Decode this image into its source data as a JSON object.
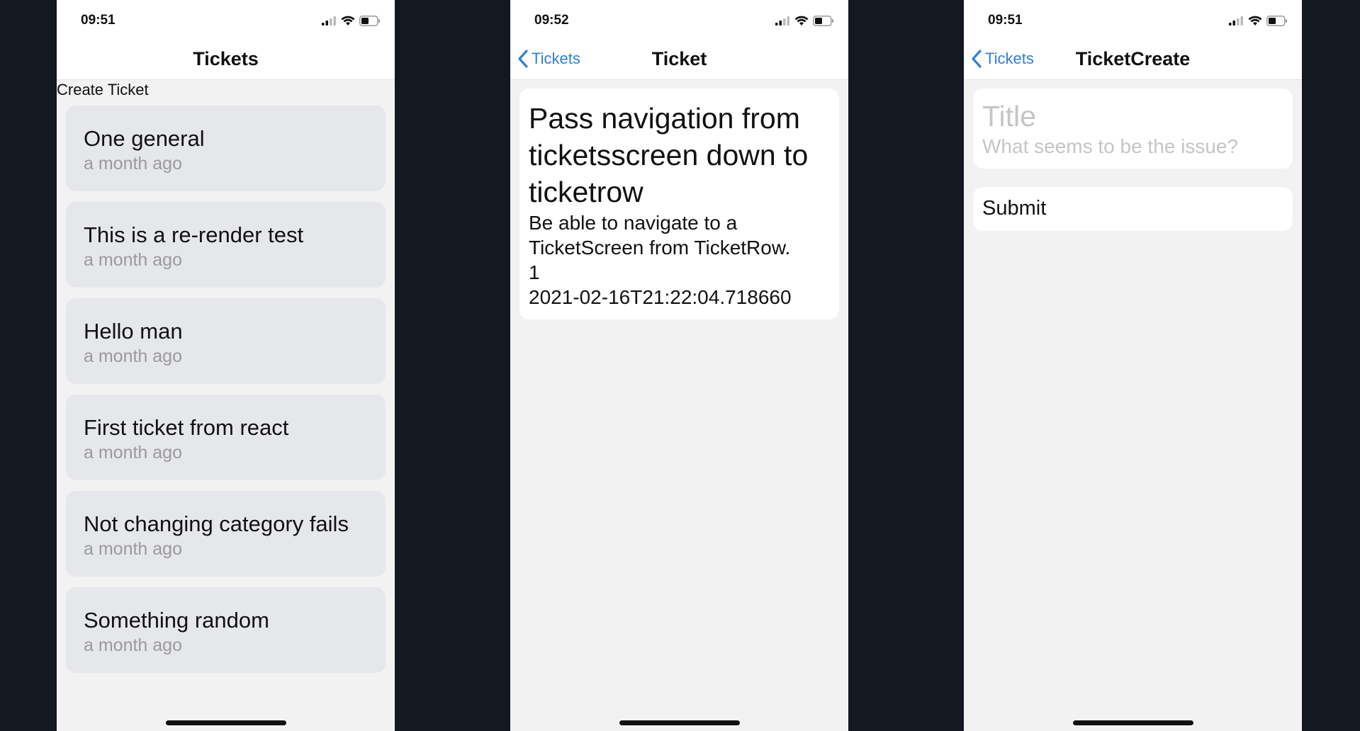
{
  "screens": [
    {
      "time": "09:51",
      "nav_title": "Tickets",
      "create_link": "Create Ticket",
      "tickets": [
        {
          "title": "One general",
          "time": "a month ago"
        },
        {
          "title": "This is a re-render test",
          "time": "a month ago"
        },
        {
          "title": "Hello man",
          "time": "a month ago"
        },
        {
          "title": "First ticket from react",
          "time": "a month ago"
        },
        {
          "title": "Not changing category fails",
          "time": "a month ago"
        },
        {
          "title": "Something random",
          "time": "a month ago"
        }
      ]
    },
    {
      "time": "09:52",
      "back_label": "Tickets",
      "nav_title": "Ticket",
      "ticket": {
        "title": "Pass navigation from ticketsscreen down to ticketrow",
        "description": "Be able to navigate to a TicketScreen from TicketRow.",
        "id": "1",
        "created": "2021-02-16T21:22:04.718660"
      }
    },
    {
      "time": "09:51",
      "back_label": "Tickets",
      "nav_title": "TicketCreate",
      "title_placeholder": "Title",
      "description_placeholder": "What seems to be the issue?",
      "submit_label": "Submit"
    }
  ],
  "colors": {
    "accent": "#2f7ed8",
    "background": "#131821",
    "card": "#e6e7eb",
    "screen": "#f2f2f2"
  },
  "icons": [
    "signal-icon",
    "wifi-icon",
    "battery-icon",
    "chevron-left-icon"
  ]
}
